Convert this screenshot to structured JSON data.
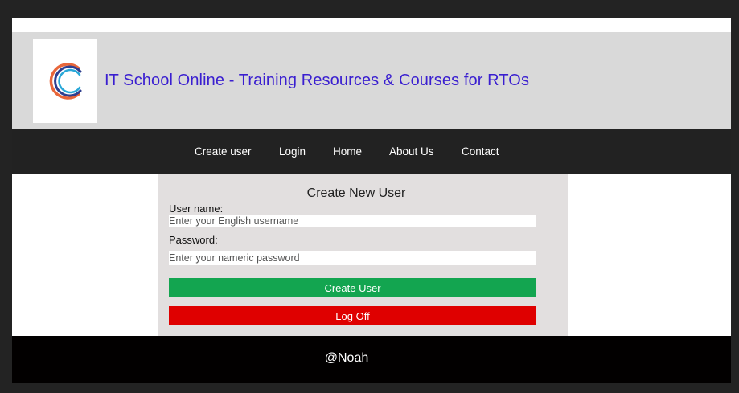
{
  "header": {
    "logo_icon": "circular-swoosh-logo-icon",
    "title": "IT School Online - Training Resources & Courses for RTOs",
    "title_color": "#3a1fd0"
  },
  "nav": {
    "items": [
      {
        "label": "Create user"
      },
      {
        "label": "Login"
      },
      {
        "label": "Home"
      },
      {
        "label": "About Us"
      },
      {
        "label": "Contact"
      }
    ]
  },
  "form": {
    "title": "Create New User",
    "username_label": "User name:",
    "username_placeholder": "Enter your English username",
    "username_value": "",
    "password_label": "Password:",
    "password_placeholder": "Enter your nameric password",
    "password_value": "",
    "create_button_label": "Create User",
    "create_button_color": "#13a550",
    "logoff_button_label": "Log Off",
    "logoff_button_color": "#df0000"
  },
  "footer": {
    "text": "@Noah"
  }
}
